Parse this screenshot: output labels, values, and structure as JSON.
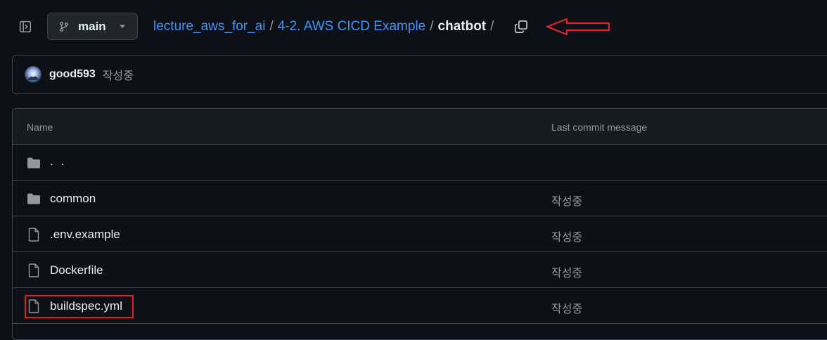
{
  "header": {
    "sidebar_toggle_icon": "sidebar-expand-icon",
    "branch": {
      "icon": "git-branch-icon",
      "label": "main",
      "caret_icon": "triangle-down-icon"
    },
    "breadcrumb": {
      "repo": "lecture_aws_for_ai",
      "folder": "4-2. AWS CICD Example",
      "current": "chatbot",
      "separator": "/"
    },
    "copy_icon": "copy-icon",
    "annotation_color": "#e5202e"
  },
  "latest_commit": {
    "author": "good593",
    "message": "작성중"
  },
  "table": {
    "columns": {
      "name": "Name",
      "message": "Last commit message"
    },
    "parent": {
      "label": ". .",
      "icon": "folder-icon"
    },
    "rows": [
      {
        "name": "common",
        "icon": "folder-icon",
        "message": "작성중"
      },
      {
        "name": ".env.example",
        "icon": "file-icon",
        "message": "작성중"
      },
      {
        "name": "Dockerfile",
        "icon": "file-icon",
        "message": "작성중"
      },
      {
        "name": "buildspec.yml",
        "icon": "file-icon",
        "message": "작성중",
        "highlighted": true
      }
    ]
  },
  "colors": {
    "background": "#0d1117",
    "link": "#4493f8",
    "muted": "#9198a1",
    "border": "#3d444d",
    "highlight": "#e5202e"
  }
}
